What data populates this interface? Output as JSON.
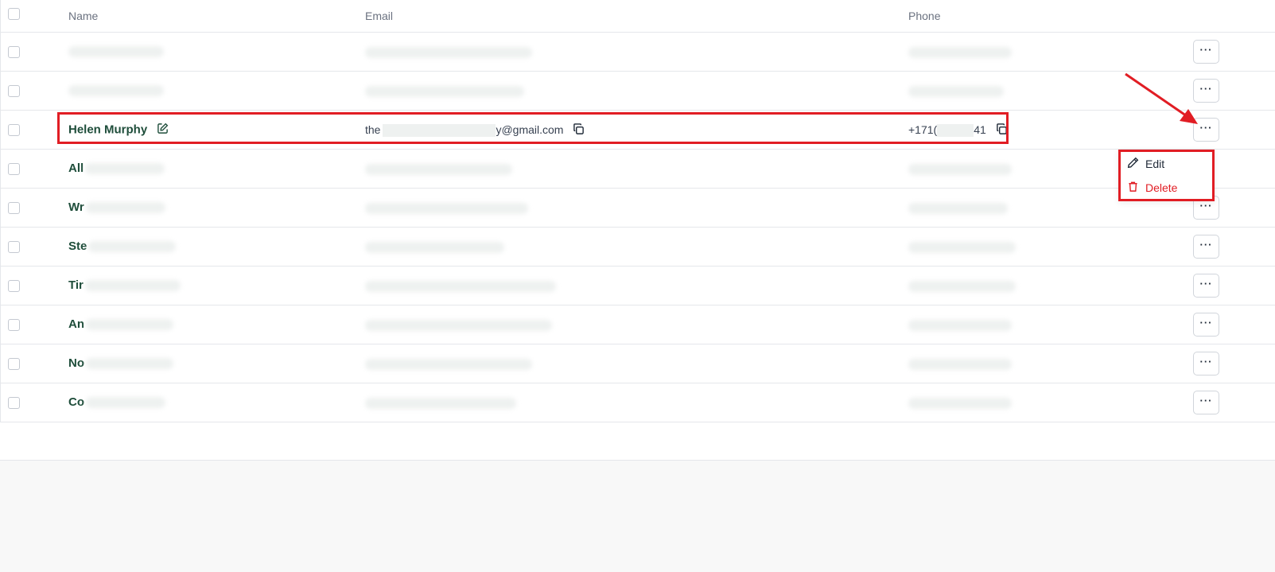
{
  "table": {
    "headers": {
      "name": "Name",
      "email": "Email",
      "phone": "Phone"
    },
    "rows": [
      {
        "name": "",
        "email": "",
        "phone": ""
      },
      {
        "name": "",
        "email": "",
        "phone": ""
      },
      {
        "name": "Helen Murphy",
        "email_prefix": "the",
        "email_suffix": "y@gmail.com",
        "phone_prefix": "+171(",
        "phone_suffix": "41"
      },
      {
        "name_partial": "All"
      },
      {
        "name_partial": "Wr"
      },
      {
        "name_partial": "Ste"
      },
      {
        "name_partial": "Tir"
      },
      {
        "name_partial": "An"
      },
      {
        "name_partial": "No"
      },
      {
        "name_partial": "Co"
      }
    ],
    "more_label": "···"
  },
  "menu": {
    "edit_label": "Edit",
    "delete_label": "Delete"
  },
  "colors": {
    "accent_name": "#1e4d3a",
    "highlight": "#e11d24",
    "delete": "#e11d24"
  },
  "icons": [
    "pencil-square-icon",
    "copy-icon",
    "pencil-icon",
    "trash-icon",
    "more-horizontal-icon"
  ]
}
